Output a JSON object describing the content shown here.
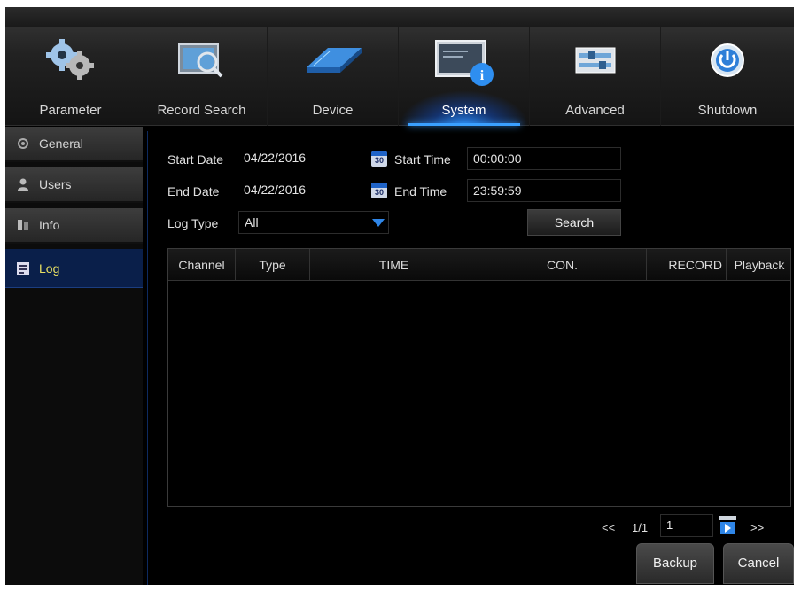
{
  "nav": {
    "tabs": [
      {
        "label": "Parameter",
        "icon": "gears-icon"
      },
      {
        "label": "Record Search",
        "icon": "film-search-icon"
      },
      {
        "label": "Device",
        "icon": "hard-drive-icon"
      },
      {
        "label": "System",
        "icon": "system-info-icon",
        "active": true
      },
      {
        "label": "Advanced",
        "icon": "sliders-icon"
      },
      {
        "label": "Shutdown",
        "icon": "power-icon"
      }
    ]
  },
  "sidebar": {
    "items": [
      {
        "label": "General",
        "icon": "gear-icon"
      },
      {
        "label": "Users",
        "icon": "user-icon"
      },
      {
        "label": "Info",
        "icon": "info-icon"
      },
      {
        "label": "Log",
        "icon": "log-icon",
        "active": true
      }
    ]
  },
  "form": {
    "start_date_label": "Start Date",
    "start_date_value": "04/22/2016",
    "start_time_label": "Start Time",
    "start_time_value": "00:00:00",
    "end_date_label": "End Date",
    "end_date_value": "04/22/2016",
    "end_time_label": "End Time",
    "end_time_value": "23:59:59",
    "log_type_label": "Log Type",
    "log_type_value": "All",
    "calendar_day": "30",
    "search_label": "Search"
  },
  "table": {
    "columns": [
      "Channel",
      "Type",
      "TIME",
      "CON.",
      "RECORD",
      "Playback"
    ],
    "rows": []
  },
  "pager": {
    "prev": "<<",
    "page_info": "1/1",
    "page_input": "1",
    "next": ">>"
  },
  "buttons": {
    "backup": "Backup",
    "cancel": "Cancel"
  },
  "colors": {
    "accent": "#3aa0ff",
    "active_sidebar_text": "#e9e062",
    "active_sidebar_bg": "#0a1f4a"
  }
}
